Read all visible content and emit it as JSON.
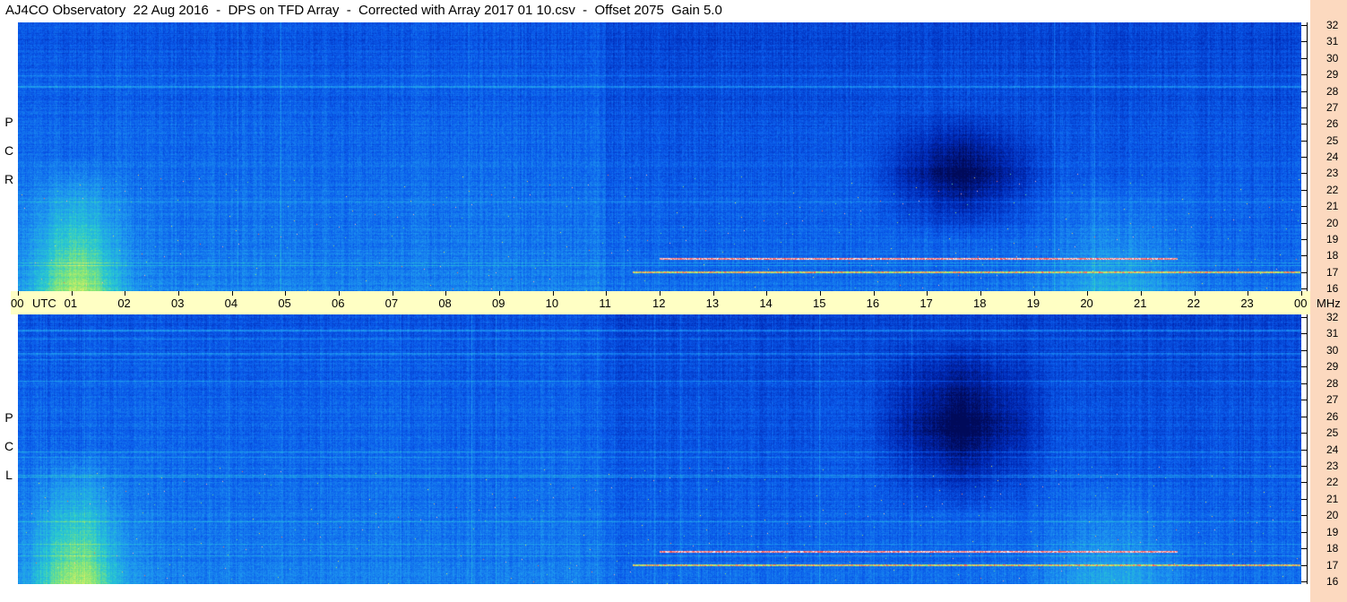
{
  "title": "AJ4CO Observatory  22 Aug 2016  -  DPS on TFD Array  -  Corrected with Array 2017 01 10.csv  -  Offset 2075  Gain 5.0",
  "panels": [
    {
      "label": [
        "R",
        "C",
        "P"
      ]
    },
    {
      "label": [
        "L",
        "C",
        "P"
      ]
    }
  ],
  "colors": {
    "title_bg": "#ffffff",
    "time_bar_bg": "#ffffc4",
    "right_strip_bg": "#fcd9bf",
    "colormap": [
      "#000a5a",
      "#0028b4",
      "#0a5aeb",
      "#1e96f0",
      "#28c8d2",
      "#82e678",
      "#e6f064",
      "#ff5050",
      "#ffffff"
    ]
  },
  "chart_data": {
    "type": "heatmap",
    "title": "AJ4CO Observatory  22 Aug 2016  -  DPS on TFD Array  -  Corrected with Array 2017 01 10.csv  -  Offset 2075  Gain 5.0",
    "x_axis": {
      "label": "UTC",
      "ticks": [
        "00",
        "01",
        "02",
        "03",
        "04",
        "05",
        "06",
        "07",
        "08",
        "09",
        "10",
        "11",
        "12",
        "13",
        "14",
        "15",
        "16",
        "17",
        "18",
        "19",
        "20",
        "21",
        "22",
        "23",
        "00"
      ],
      "range": [
        0,
        24
      ]
    },
    "y_axis": {
      "label": "MHz",
      "ticks": [
        "16",
        "17",
        "18",
        "19",
        "20",
        "21",
        "22",
        "23",
        "24",
        "25",
        "26",
        "27",
        "28",
        "29",
        "30",
        "31",
        "32"
      ],
      "range": [
        16,
        32
      ]
    },
    "series": [
      {
        "name": "RCP",
        "features": {
          "bright_low_freq_band_utc": [
            0.2,
            1.9
          ],
          "dark_region_utc": [
            15.8,
            19.5
          ],
          "dark_region_mhz": [
            20,
            26
          ],
          "strong_line_mhz": 17.9,
          "strong_line_utc": [
            12,
            21.7
          ]
        }
      },
      {
        "name": "LCP",
        "features": {
          "bright_low_freq_band_utc": [
            0.2,
            1.9
          ],
          "dark_region_utc": [
            15.8,
            19.5
          ],
          "dark_region_mhz": [
            21,
            30
          ],
          "strong_line_mhz": 17.9,
          "strong_line_utc": [
            12,
            21.7
          ]
        }
      }
    ]
  }
}
